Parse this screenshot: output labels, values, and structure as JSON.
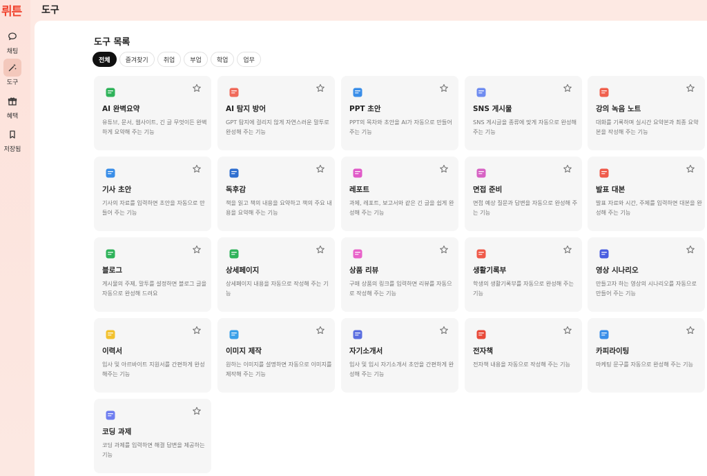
{
  "app": {
    "logo": "뤼튼",
    "header_title": "도구"
  },
  "nav": [
    {
      "label": "채팅",
      "icon": "chat-bubble-icon",
      "active": false
    },
    {
      "label": "도구",
      "icon": "magic-wand-icon",
      "active": true
    },
    {
      "label": "혜택",
      "icon": "gift-icon",
      "active": false
    },
    {
      "label": "저장됨",
      "icon": "bookmark-icon",
      "active": false
    }
  ],
  "section": {
    "title": "도구 목록"
  },
  "filters": [
    "전체",
    "즐겨찾기",
    "취업",
    "부업",
    "학업",
    "업무"
  ],
  "active_filter": "전체",
  "cards": [
    {
      "title": "AI 완벽요약",
      "desc": "유튜브, 문서, 웹사이트, 긴 글 무엇이든 완벽하게 요약해 주는 기능",
      "icon": "summary-icon",
      "color": "#2fb35a"
    },
    {
      "title": "AI 탐지 방어",
      "desc": "GPT 탐지에 걸리지 않게 자연스러운 말투로 완성해 주는 기능",
      "icon": "shield-icon",
      "color": "#f06a5a"
    },
    {
      "title": "PPT 초안",
      "desc": "PPT의 목차와 초안을 AI가 자동으로 만들어 주는 기능",
      "icon": "presentation-icon",
      "color": "#3a8ee8"
    },
    {
      "title": "SNS 게시물",
      "desc": "SNS 게시글을 종류에 맞게 자동으로 완성해 주는 기능",
      "icon": "phone-icon",
      "color": "#6f8cf0"
    },
    {
      "title": "강의 녹음 노트",
      "desc": "대화를 기록하며 실시간 요약본과 최종 요약본을 작성해 주는 기능",
      "icon": "recorder-icon",
      "color": "#f0604d"
    },
    {
      "title": "기사 초안",
      "desc": "기사의 자료를 입력하면 초안을 자동으로 만들어 주는 기능",
      "icon": "newspaper-icon",
      "color": "#3a8ee8"
    },
    {
      "title": "독후감",
      "desc": "책을 읽고 책의 내용을 요약하고 책의 주요 내용을 요약해 주는 기능",
      "icon": "book-icon",
      "color": "#2f6fd0"
    },
    {
      "title": "레포트",
      "desc": "과제, 레포트, 보고서와 같은 긴 글을 쉽게 완성해 주는 기능",
      "icon": "report-icon",
      "color": "#e05ac8"
    },
    {
      "title": "면접 준비",
      "desc": "면접 예상 질문과 답변을 자동으로 완성해 주는 기능",
      "icon": "briefcase-icon",
      "color": "#d763c4"
    },
    {
      "title": "발표 대본",
      "desc": "발표 자료와 시간, 주제를 입력하면 대본을 완성해 주는 기능",
      "icon": "script-icon",
      "color": "#ef5a4a"
    },
    {
      "title": "블로그",
      "desc": "게시물의 주제, 말투를 설정하면 블로그 글을 자동으로 완성해 드려요",
      "icon": "blog-icon",
      "color": "#2fb35a"
    },
    {
      "title": "상세페이지",
      "desc": "상세페이지 내용을 자동으로 작성해 주는 기능",
      "icon": "webpage-icon",
      "color": "#2fb35a"
    },
    {
      "title": "상품 리뷰",
      "desc": "구매 상품의 링크를 입력하면 리뷰를 자동으로 작성해 주는 기능",
      "icon": "review-icon",
      "color": "#e862c9"
    },
    {
      "title": "생활기록부",
      "desc": "학생의 생활기록부를 자동으로 완성해 주는 기능",
      "icon": "school-icon",
      "color": "#ef5a4a"
    },
    {
      "title": "영상 시나리오",
      "desc": "만들고자 하는 영상의 시나리오를 자동으로 만들어 주는 기능",
      "icon": "video-icon",
      "color": "#4a5ee0"
    },
    {
      "title": "이력서",
      "desc": "입사 및 아르바이트 지원서를 간편하게 완성해주는 기능",
      "icon": "resume-icon",
      "color": "#f2c12e"
    },
    {
      "title": "이미지 제작",
      "desc": "원하는 이미지를 설명하면 자동으로 이미지를 제작해 주는 기능",
      "icon": "image-icon",
      "color": "#3aa0e8"
    },
    {
      "title": "자기소개서",
      "desc": "입사 및 입시 자기소개서 초안을 간편하게 완성해 주는 기능",
      "icon": "profile-doc-icon",
      "color": "#5a6ee0"
    },
    {
      "title": "전자책",
      "desc": "전자책 내용을 자동으로 작성해 주는 기능",
      "icon": "ebook-icon",
      "color": "#e84a3a"
    },
    {
      "title": "카피라이팅",
      "desc": "마케팅 문구를 자동으로 완성해 주는 기능",
      "icon": "pen-icon",
      "color": "#3a8ee8"
    },
    {
      "title": "코딩 과제",
      "desc": "코딩 과제를 입력하면 해결 답변을 제공하는 기능",
      "icon": "code-window-icon",
      "color": "#6f7ef0"
    }
  ]
}
